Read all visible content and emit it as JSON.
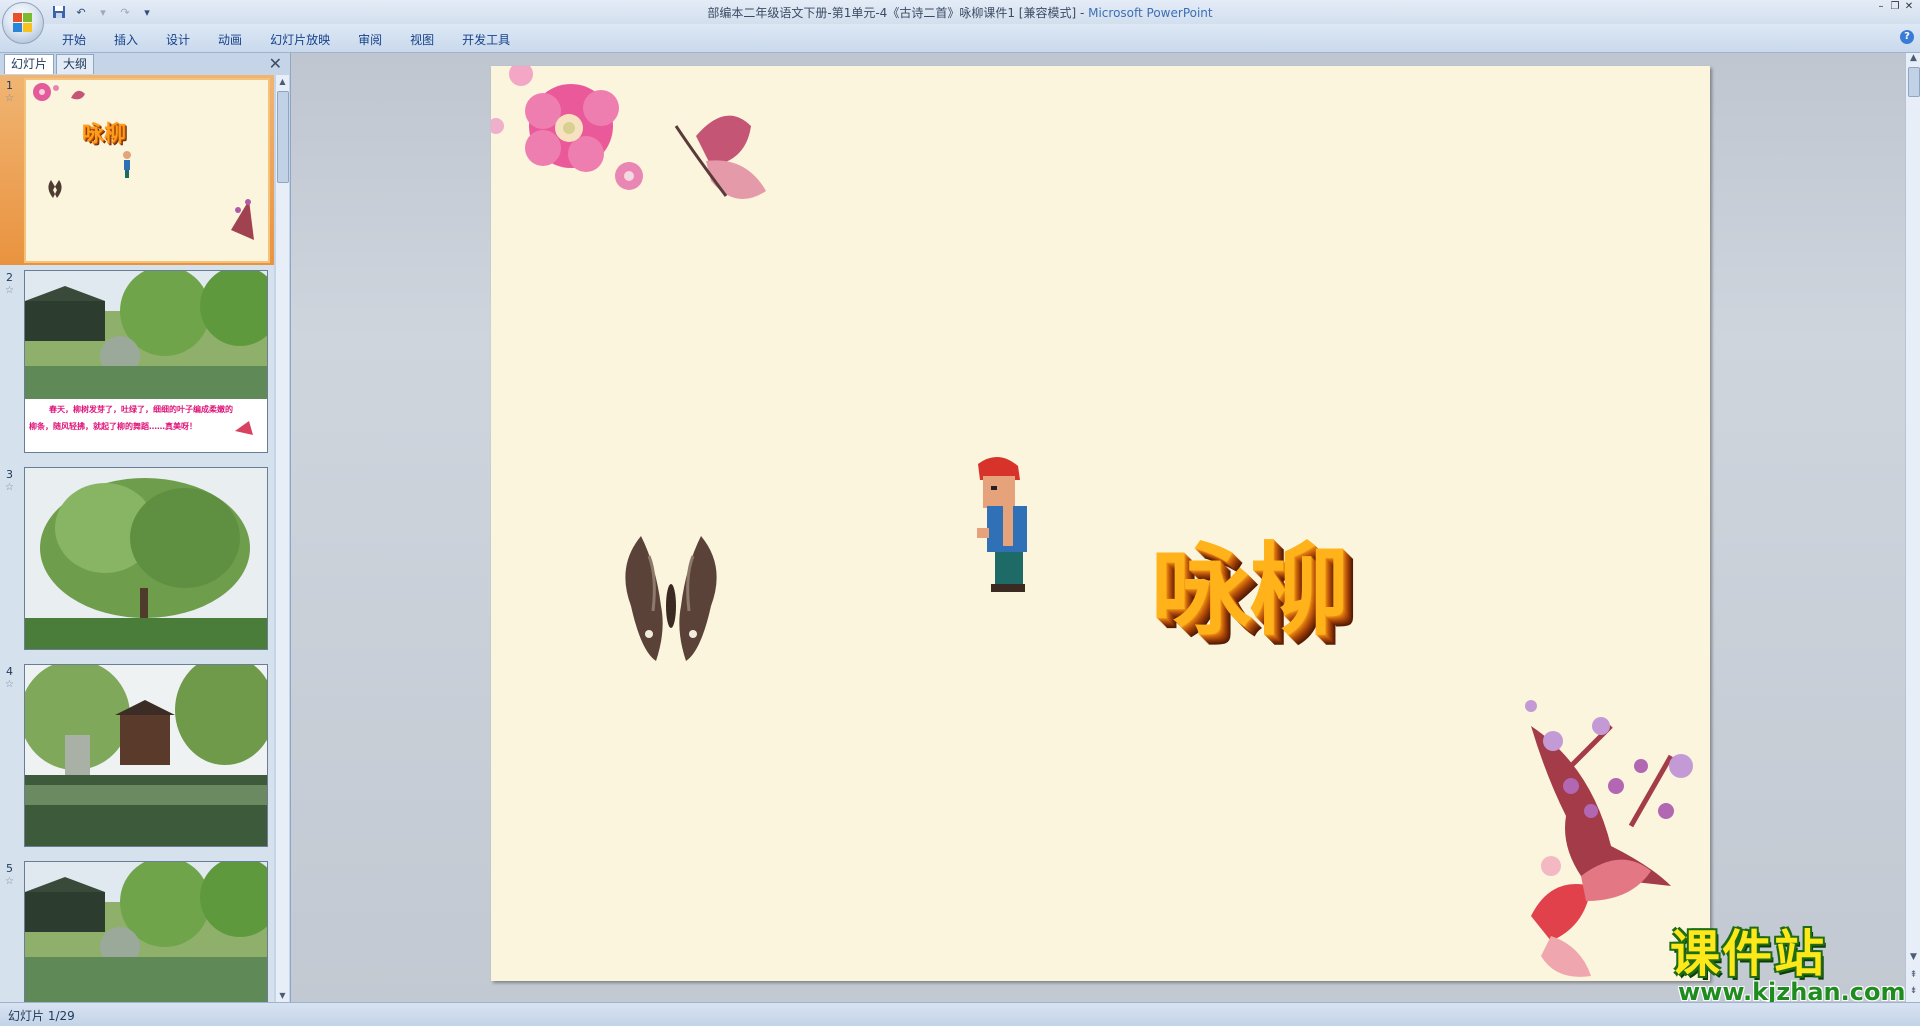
{
  "window": {
    "title": "部编本二年级语文下册-第1单元-4《古诗二首》咏柳课件1 [兼容模式]",
    "app_sep": " - ",
    "app_name": "Microsoft PowerPoint"
  },
  "quick_access": [
    "save-icon",
    "undo-icon",
    "redo-icon",
    "customize-dropdown-icon"
  ],
  "ribbon": {
    "tabs": [
      "开始",
      "插入",
      "设计",
      "动画",
      "幻灯片放映",
      "审阅",
      "视图",
      "开发工具"
    ]
  },
  "left_pane": {
    "tabs": [
      "幻灯片",
      "大纲"
    ],
    "slides": [
      {
        "number": "1",
        "title": "咏柳"
      },
      {
        "number": "2",
        "caption_line1": "春天，柳树发芽了，吐绿了，细细的叶子编成柔嫩的",
        "caption_line2": "柳条，随风轻拂，就起了柳的舞蹈……真美呀！"
      },
      {
        "number": "3"
      },
      {
        "number": "4"
      },
      {
        "number": "5"
      }
    ]
  },
  "slide": {
    "title": "咏柳"
  },
  "status": {
    "slide_counter": "幻灯片 1/29"
  },
  "watermark": {
    "text": "课件站",
    "url": "www.kjzhan.com"
  }
}
